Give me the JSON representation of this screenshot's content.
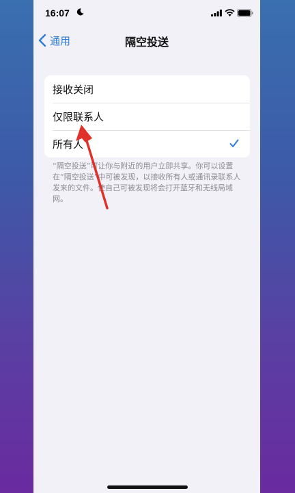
{
  "status_bar": {
    "time": "16:07",
    "icons": [
      "moon-icon",
      "signal-icon",
      "wifi-icon",
      "battery-icon"
    ]
  },
  "nav": {
    "back_label": "通用",
    "title": "隔空投送"
  },
  "options": [
    {
      "label": "接收关闭",
      "selected": false
    },
    {
      "label": "仅限联系人",
      "selected": false
    },
    {
      "label": "所有人",
      "selected": true
    }
  ],
  "footnote": "“隔空投送”可让你与附近的用户立即共享。你可以设置在“隔空投送”中可被发现，以接收所有人或通讯录联系人发来的文件。使自己可被发现将会打开蓝牙和无线局域网。",
  "colors": {
    "accent": "#2f7bd8",
    "annotation_arrow": "#e0302a"
  }
}
